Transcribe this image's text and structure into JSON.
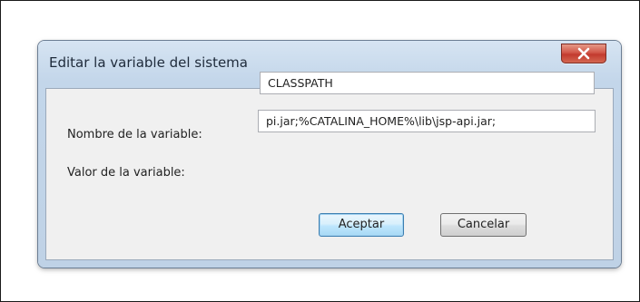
{
  "dialog": {
    "title": "Editar la variable del sistema",
    "close_icon": "close-x-icon"
  },
  "fields": {
    "name_label": "Nombre de la variable:",
    "name_value": "CLASSPATH",
    "value_label": "Valor de la variable:",
    "value_value": "pi.jar;%CATALINA_HOME%\\lib\\jsp-api.jar;"
  },
  "buttons": {
    "ok": "Aceptar",
    "cancel": "Cancelar"
  },
  "colors": {
    "close_button": "#c8463a",
    "accent_button_border": "#3c7fb1"
  }
}
